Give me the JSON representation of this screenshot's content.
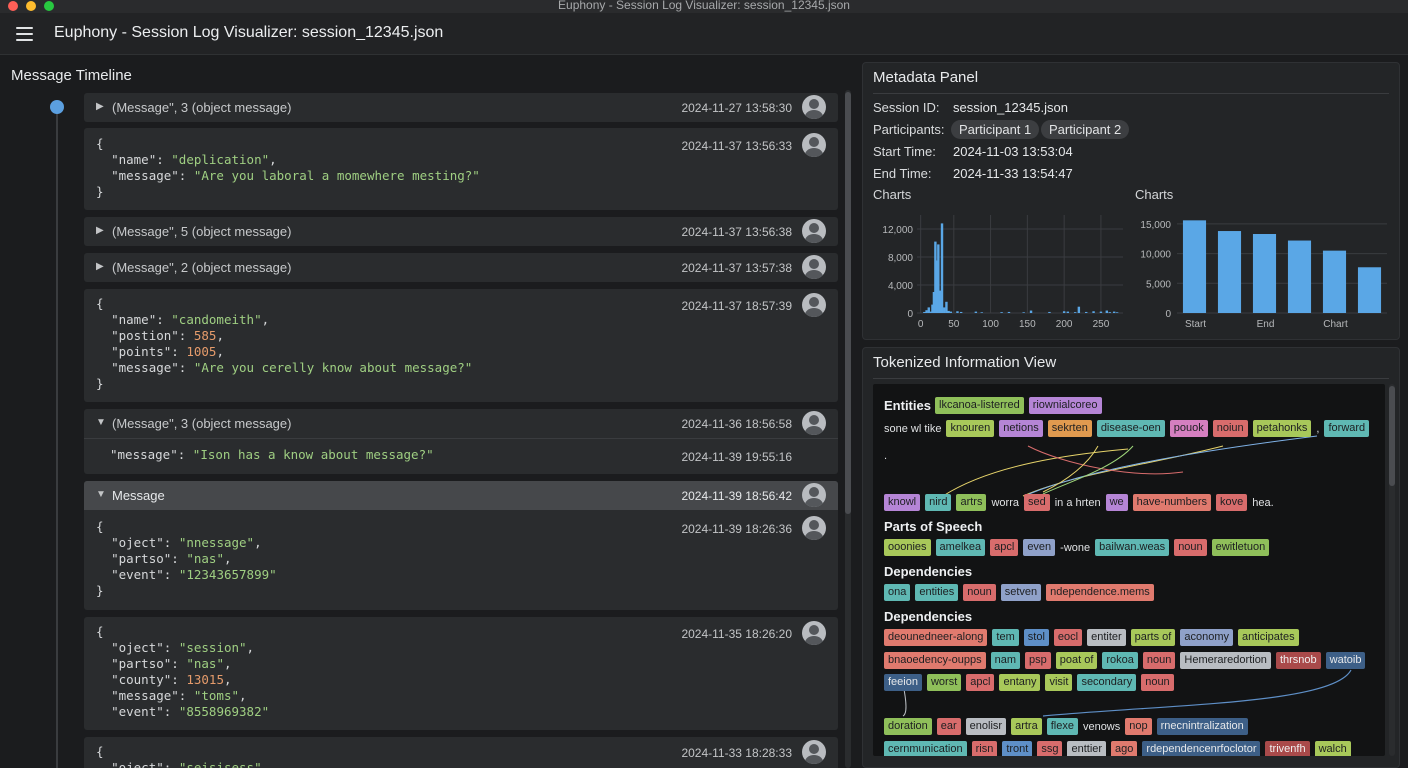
{
  "window": {
    "title": "Euphony - Session Log Visualizer: session_12345.json"
  },
  "app": {
    "title": "Euphony - Session Log Visualizer: session_12345.json"
  },
  "timeline": {
    "title": "Message Timeline",
    "items": [
      {
        "label": "(Message\", 3 (object message)",
        "timestamp": "2024-11-27 13:58:30"
      },
      {
        "timestamp": "2024-11-37 13:56:33"
      },
      {
        "label": "(Message\", 5 (object message)",
        "timestamp": "2024-11-37 13:56:38"
      },
      {
        "label": "(Message\", 2 (object message)",
        "timestamp": "2024-11-37 13:57:38"
      },
      {
        "timestamp": "2024-11-37 18:57:39"
      },
      {
        "label": "(Message\", 3 (object message)",
        "timestamp": "2024-11-36 18:56:58",
        "timestamp2": "2024-11-39 19:55:16"
      },
      {
        "label": "Message",
        "timestamp": "2024-11-39 18:56:42",
        "timestamp2": "2024-11-39 18:26:36"
      },
      {
        "timestamp": "2024-11-35 18:26:20"
      },
      {
        "timestamp": "2024-11-33 18:28:33"
      }
    ]
  },
  "code": {
    "c1_open": "{",
    "c1_k1": "\"name\"",
    "c1_v1": "\"deplication\"",
    "c1_k2": "\"message\"",
    "c1_v2": "\"Are you laboral a momewhere mesting?\"",
    "c1_close": "}",
    "c2_open": "{",
    "c2_k1": "\"name\"",
    "c2_v1": "\"candomeith\"",
    "c2_k2": "\"postion\"",
    "c2_v2": "585",
    "c2_k3": "\"points\"",
    "c2_v3": "1005",
    "c2_k4": "\"message\"",
    "c2_v4": "\"Are you cerelly know about message?\"",
    "c2_close": "}",
    "c3_k1": "\"message\"",
    "c3_v1": "\"Ison has a know about message?\"",
    "c4_open": "{",
    "c4_k1": "\"oject\"",
    "c4_v1": "\"nnessage\"",
    "c4_k2": "\"partso\"",
    "c4_v2": "\"nas\"",
    "c4_k3": "\"event\"",
    "c4_v3": "\"12343657899\"",
    "c4_close": "}",
    "c5_open": "{",
    "c5_k1": "\"oject\"",
    "c5_v1": "\"session\"",
    "c5_k2": "\"partso\"",
    "c5_v2": "\"nas\"",
    "c5_k3": "\"county\"",
    "c5_v3": "13015",
    "c5_k4": "\"message\"",
    "c5_v4": "\"toms\"",
    "c5_k5": "\"event\"",
    "c5_v5": "\"8558969382\"",
    "c6_open": "{",
    "c6_k1": "\"oject\"",
    "c6_v1": "\"seisisess\""
  },
  "metadata": {
    "title": "Metadata Panel",
    "session_label": "Session ID:",
    "session_value": "session_12345.json",
    "participants_label": "Participants:",
    "participants": [
      "Participant 1",
      "Participant 2"
    ],
    "start_label": "Start Time:",
    "start_value": "2024-11-03 13:53:04",
    "end_label": "End Time:",
    "end_value": "2024-11-33 13:54:47",
    "chart1_title": "Charts",
    "chart2_title": "Charts"
  },
  "chart_data": [
    {
      "type": "bar",
      "title": "Charts",
      "xlim": [
        0,
        280
      ],
      "ylim": [
        0,
        14000
      ],
      "yticks": [
        "0",
        "4,000",
        "8,000",
        "12,000"
      ],
      "ytick_values": [
        0,
        4000,
        8000,
        12000
      ],
      "xticks": [
        "0",
        "50",
        "100",
        "150",
        "200",
        "250"
      ],
      "xtick_values": [
        5,
        50,
        100,
        150,
        200,
        250
      ],
      "x": [
        10,
        13,
        16,
        19,
        21,
        23,
        25,
        27,
        29,
        31,
        34,
        37,
        40,
        43,
        46,
        55,
        60,
        80,
        88,
        115,
        125,
        145,
        155,
        180,
        200,
        205,
        215,
        220,
        230,
        240,
        250,
        258,
        262,
        268,
        272
      ],
      "values": [
        150,
        400,
        800,
        200,
        1200,
        3000,
        10200,
        7500,
        9800,
        3200,
        12800,
        800,
        1600,
        300,
        200,
        250,
        150,
        200,
        100,
        120,
        150,
        100,
        350,
        150,
        250,
        200,
        120,
        900,
        150,
        250,
        200,
        350,
        120,
        200,
        100
      ],
      "grid": true
    },
    {
      "type": "bar",
      "title": "Charts",
      "ylim": [
        0,
        16500
      ],
      "yticks": [
        "0",
        "5,000",
        "10,000",
        "15,000"
      ],
      "ytick_values": [
        0,
        5000,
        10000,
        15000
      ],
      "categories": [
        "Start",
        "",
        "End",
        "",
        "Chart",
        ""
      ],
      "values": [
        15600,
        13800,
        13300,
        12200,
        10500,
        7700
      ],
      "grid": true
    }
  ],
  "tokens": {
    "title": "Tokenized Information View",
    "entities_heading": "Entities",
    "row1": [
      "lkcanoa-listerred",
      "riownialcoreo"
    ],
    "row2_prefix": "sone wl tike",
    "row2": [
      "knouren",
      "netions",
      "sekrten",
      "disease-oen",
      "pouok",
      "noiun",
      "petahonks"
    ],
    "row2_sep": ",",
    "row2_tail": "forward",
    "row3_text": ".",
    "row4": [
      "knowl",
      "nird",
      "artrs"
    ],
    "row4_word": "worra",
    "row4_b": "sed",
    "row4_mid": "in a hrten",
    "row4_c": [
      "we",
      "have-numbers",
      "kove"
    ],
    "row4_end": "hea.",
    "pos_heading": "Parts of Speech",
    "pos_row": [
      "ooonies",
      "amelkea",
      "apcl",
      "even"
    ],
    "pos_word": "-wone",
    "pos_row_b": [
      "bailwan.weas",
      "noun",
      "ewitletuon"
    ],
    "dep_heading1": "Dependencies",
    "dep_row1": [
      "ona",
      "entities",
      "noun",
      "setven",
      "ndependence.mems"
    ],
    "dep_heading2": "Dependencies",
    "dep_row2": [
      "deounedneer-along",
      "tem",
      "stol",
      "eocl",
      "entiter",
      "parts of",
      "aconomy",
      "anticipates"
    ],
    "dep_row3": [
      "bnaoedency-oupps",
      "nam",
      "psp",
      "poat of",
      "rokoa",
      "noun",
      "Hemeraredortion",
      "thrsnob",
      "watoib"
    ],
    "dep_row4": [
      "feeion",
      "worst",
      "apcl",
      "entany",
      "visit",
      "secondary",
      "noun"
    ],
    "dep_row5": [
      "doration",
      "ear",
      "enolisr",
      "artra",
      "flexe"
    ],
    "dep_row5_word": "venows",
    "dep_row5_b": [
      "nop",
      "rnecnintralization"
    ],
    "dep_row6": [
      "cernmunication",
      "risn",
      "tront",
      "ssg",
      "enttier",
      "ago",
      "rdependencenrfoclotor",
      "trivenfh",
      "walch"
    ]
  }
}
